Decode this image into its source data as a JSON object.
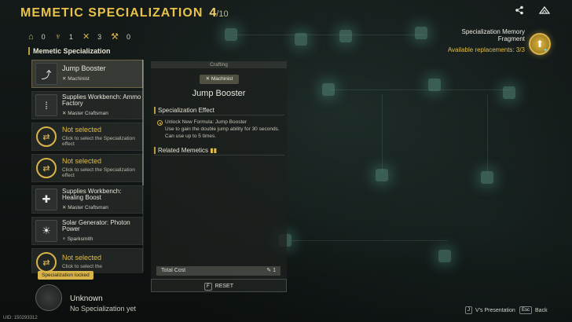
{
  "header": {
    "title": "MEMETIC SPECIALIZATION",
    "count": "4",
    "total": "/10"
  },
  "icons": {
    "share": "share-icon",
    "brand": "brand-icon"
  },
  "stats": [
    {
      "icon": "house-icon",
      "value": "0"
    },
    {
      "icon": "wing-icon",
      "value": "1"
    },
    {
      "icon": "tools-icon",
      "value": "3"
    },
    {
      "icon": "hammer-icon",
      "value": "0"
    }
  ],
  "list": {
    "title": "Memetic Specialization",
    "items": [
      {
        "name": "Jump Booster",
        "role": "Machinist",
        "selected": true
      },
      {
        "name": "Supplies Workbench: Ammo Factory",
        "role": "Master Craftsman"
      },
      {
        "name": "Not selected",
        "sub": "Click to select the Specialization effect"
      },
      {
        "name": "Not selected",
        "sub": "Click to select the Specialization effect"
      },
      {
        "name": "Supplies Workbench: Healing Boost",
        "role": "Master Craftsman"
      },
      {
        "name": "Solar Generator: Photon Power",
        "role": "Sparksmith"
      },
      {
        "name": "Not selected",
        "sub": "Click to select the"
      }
    ],
    "locked_label": "Specialization locked"
  },
  "profile": {
    "name": "Unknown",
    "status": "No Specialization yet",
    "uid": "UID: 150293312"
  },
  "detail": {
    "category": "Crafting",
    "role": "Machinist",
    "title": "Jump Booster",
    "effect_heading": "Specialization Effect",
    "effect_text": "Unlock New Formula: Jump Booster\nUse to gain the double jump ability for 30 seconds. Can use up to 5 times.",
    "related_heading": "Related Memetics",
    "cost_label": "Total Cost",
    "cost_value": "1",
    "reset_key": "F",
    "reset_label": "RESET"
  },
  "fragment": {
    "title_line1": "Specialization Memory",
    "title_line2": "Fragment",
    "replacements": "Available replacements: 3/3"
  },
  "hints": [
    {
      "key": "J",
      "label": "V's Presentation"
    },
    {
      "key": "Esc",
      "label": "Back"
    }
  ],
  "colors": {
    "accent": "#d9b44a",
    "title": "#e9c24a",
    "panel": "#1c201e"
  }
}
